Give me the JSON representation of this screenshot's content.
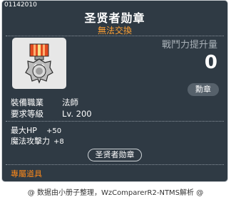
{
  "item": {
    "id": "01142010",
    "name": "圣贤者勋章",
    "trade_status": "無法交換",
    "icon": "medal-icon",
    "power_label": "戰鬥力提升量",
    "power_value": "0",
    "type_badge": "勳章"
  },
  "requirements": [
    {
      "label": "裝備職業",
      "value": "法師"
    },
    {
      "label": "要求等級",
      "value": "Lv. 200"
    }
  ],
  "stats": [
    {
      "label": "最大HP",
      "value": "+50"
    },
    {
      "label": "魔法攻擊力",
      "value": "+8"
    }
  ],
  "set_tag": "圣贤者勋章",
  "exclusive_label": "專屬道具",
  "footer": "@ 数据由小册子整理，WzComparerR2-NTMS解析 @",
  "colors": {
    "background": "#2f3a44",
    "trade_status": "#ffa033",
    "exclusive": "#ff8a1a"
  }
}
